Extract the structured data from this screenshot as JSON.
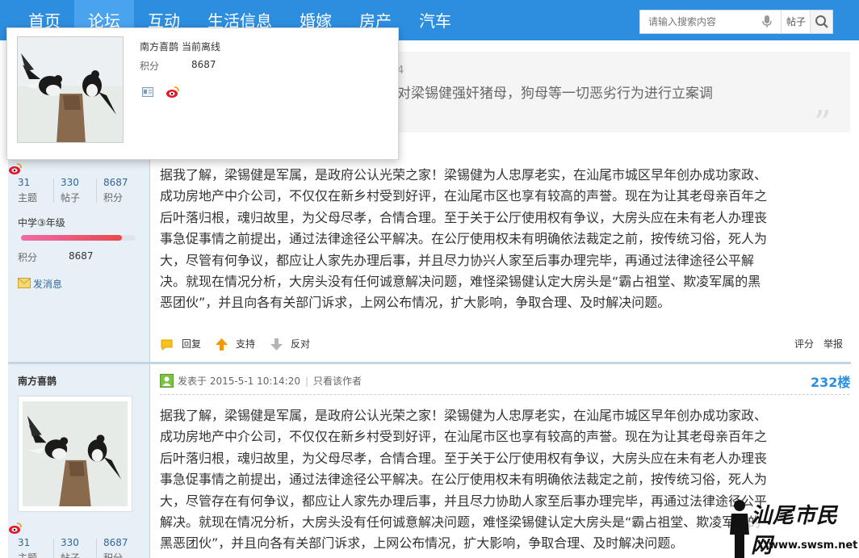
{
  "nav": {
    "items": [
      "首页",
      "论坛",
      "互动",
      "生活信息",
      "婚嫁",
      "房产",
      "汽车"
    ],
    "active_index": 1
  },
  "search": {
    "placeholder": "请输入搜索内容",
    "type_label": "帖子"
  },
  "popup": {
    "name": "南方喜鹊",
    "status": "当前离线",
    "credit_label": "积分",
    "credit_value": "8687"
  },
  "quote": {
    "meta_fragment": "4",
    "text_fragment": "对梁锡健强奸猪母，狗母等一切恶劣行为进行立案调"
  },
  "user1": {
    "stats": [
      {
        "num": "31",
        "label": "主题"
      },
      {
        "num": "330",
        "label": "帖子"
      },
      {
        "num": "8687",
        "label": "积分"
      }
    ],
    "level": "中学③年级",
    "level_progress": 0.88,
    "credit_label": "积分",
    "credit_value": "8687",
    "message_link": "发消息"
  },
  "post1": {
    "lines": [
      "据我了解，梁锡健是军属，是政府公认光荣之家！梁锡健为人忠厚老实，在汕尾市城区早年创办成功家政、",
      "成功房地产中介公司，不仅仅在新乡村受到好评，在汕尾市区也享有较高的声誉。现在为让其老母亲百年之",
      "后叶落归根，魂归故里，为父母尽孝，合情合理。至于关于公厅使用权有争议，大房头应在未有老人办理丧",
      "事急促事情之前提出，通过法律途径公平解决。在公厅使用权未有明确依法裁定之前，按传统习俗，死人为",
      "大，尽管有何争议，都应让人家先办理后事，并且尽力协兴人家至后事办理完毕，再通过法律途径公平解",
      "决。就现在情况分析，大房头没有任何诚意解决问题，难怪梁锡健认定大房头是“霸占祖堂、欺凌军属的黑",
      "恶团伙”，并且向各有关部门诉求，上网公布情况，扩大影响，争取合理、及时解决问题。"
    ]
  },
  "actions": {
    "reply": "回复",
    "support": "支持",
    "oppose": "反对",
    "rate": "评分",
    "report": "举报"
  },
  "post2": {
    "author": "南方喜鹊",
    "posted_label": "发表于 2015-5-1 10:14:20",
    "only_author": "只看该作者",
    "floor": "232楼",
    "stats": [
      {
        "num": "31",
        "label": "主题"
      },
      {
        "num": "330",
        "label": "帖子"
      },
      {
        "num": "8687",
        "label": "积分"
      }
    ],
    "lines": [
      "据我了解，梁锡健是军属，是政府公认光荣之家！梁锡健为人忠厚老实，在汕尾市城区早年创办成功家政、",
      "成功房地产中介公司，不仅仅在新乡村受到好评，在汕尾市区也享有较高的声誉。现在为让其老母亲百年之",
      "后叶落归根，魂归故里，为父母尽孝，合情合理。至于关于公厅使用权有争议，大房头应在未有老人办理丧",
      "事急促事情之前提出，通过法律途径公平解决。在公厅使用权未有明确依法裁定之前，按传统习俗，死人为",
      "大，尽管存在有何争议，都应让人家先办理后事，并且尽力协助人家至后事办理完毕，再通过法律途径公平",
      "解决。就现在情况分析，大房头没有任何诚意解决问题，难怪梁锡健认定大房头是“霸占祖堂、欺凌军属的",
      "黑恶团伙”，并且向各有关部门诉求，上网公布情况，扩大影响，争取合理、及时解决问题。"
    ]
  },
  "watermark": {
    "brand": "汕尾市民网",
    "url": "www.swsm.net"
  },
  "colors": {
    "nav_bg": "#2d8ee0",
    "sidebar_bg": "#e8f0f7",
    "floor": "#2b8fe0"
  }
}
